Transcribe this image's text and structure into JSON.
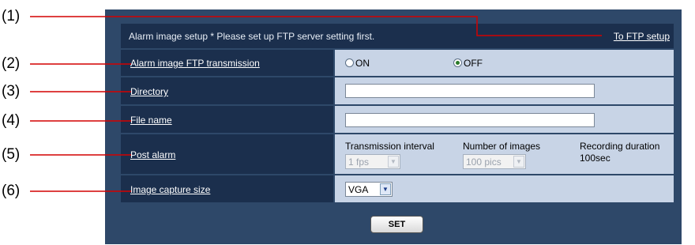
{
  "callouts": [
    "(1)",
    "(2)",
    "(3)",
    "(4)",
    "(5)",
    "(6)"
  ],
  "header": {
    "title": "Alarm image setup   * Please set up FTP server setting first.",
    "ftp_link": "To FTP setup"
  },
  "rows": {
    "ftp_transmission": {
      "label": "Alarm image FTP transmission",
      "on_label": "ON",
      "off_label": "OFF",
      "selected": "OFF"
    },
    "directory": {
      "label": "Directory",
      "value": ""
    },
    "file_name": {
      "label": "File name",
      "value": ""
    },
    "post_alarm": {
      "label": "Post alarm",
      "transmission_interval_label": "Transmission interval",
      "transmission_interval_value": "1 fps",
      "number_of_images_label": "Number of images",
      "number_of_images_value": "100 pics",
      "recording_duration_label": "Recording duration",
      "recording_duration_value": "100sec"
    },
    "image_capture_size": {
      "label": "Image capture size",
      "value": "VGA"
    }
  },
  "set_button": "SET",
  "colors": {
    "panel_bg": "#2e4869",
    "label_bg": "#1b2f4d",
    "value_bg": "#c8d4e6",
    "callout_line": "#d40000"
  },
  "icons": {
    "dropdown": "chevron-down-icon",
    "radio": "radio-icon"
  }
}
